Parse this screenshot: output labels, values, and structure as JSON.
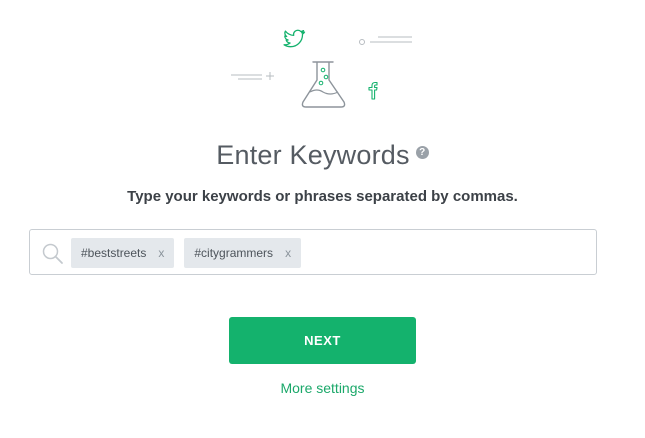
{
  "illustration": {
    "icons": [
      "twitter-icon",
      "flask-icon",
      "facebook-icon"
    ],
    "accent_color": "#14b26d",
    "line_color": "#b7bcc1"
  },
  "header": {
    "title": "Enter Keywords",
    "help_icon": "?",
    "subtitle": "Type your keywords or phrases separated by commas."
  },
  "keywords": {
    "tags": [
      {
        "label": "#beststreets",
        "remove": "x"
      },
      {
        "label": "#citygrammers",
        "remove": "x"
      }
    ],
    "input_value": ""
  },
  "actions": {
    "next_label": "NEXT",
    "more_settings_label": "More settings",
    "primary_color": "#14b26d"
  }
}
